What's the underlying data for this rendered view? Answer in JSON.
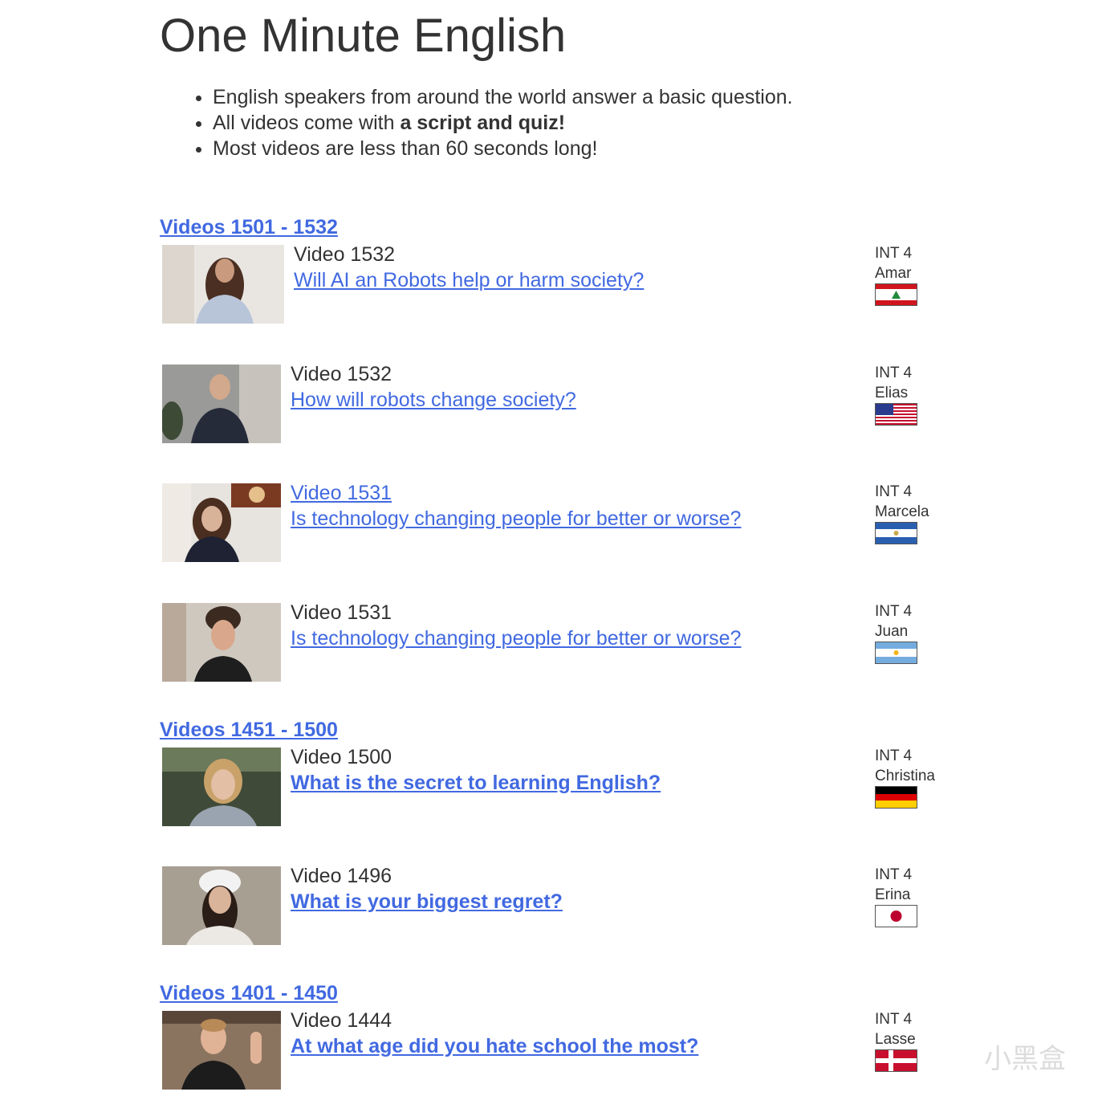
{
  "page": {
    "title": "One Minute English",
    "bullets": {
      "b1": "English speakers from around the world answer a basic question.",
      "b2_prefix": "All videos come with ",
      "b2_bold": "a script and quiz!",
      "b3": "Most videos are less than 60 seconds long!"
    }
  },
  "groups": [
    {
      "label": "Videos 1501 - 1532"
    },
    {
      "label": "Videos 1451 - 1500"
    },
    {
      "label": "Videos 1401 - 1450"
    }
  ],
  "videos": [
    {
      "number": "Video 1532",
      "question": "Will AI an Robots help or harm society?",
      "level": "INT 4",
      "speaker": "Amar",
      "flag_icon": "lebanon-flag-icon"
    },
    {
      "number": "Video 1532",
      "question": "How will robots change society?",
      "level": "INT 4",
      "speaker": "Elias",
      "flag_icon": "usa-flag-icon"
    },
    {
      "number": "Video 1531",
      "question": "Is technology changing people for better or worse?",
      "level": "INT 4",
      "speaker": "Marcela",
      "flag_icon": "el-salvador-flag-icon"
    },
    {
      "number": "Video 1531",
      "question": "Is technology changing people for better or worse?",
      "level": "INT 4",
      "speaker": "Juan",
      "flag_icon": "argentina-flag-icon"
    },
    {
      "number": "Video 1500",
      "question": "What is the secret to learning English?",
      "level": "INT 4",
      "speaker": "Christina",
      "flag_icon": "germany-flag-icon"
    },
    {
      "number": "Video 1496",
      "question": "What is your biggest regret?",
      "level": "INT 4",
      "speaker": "Erina",
      "flag_icon": "japan-flag-icon"
    },
    {
      "number": "Video 1444",
      "question": "At what age did you hate school the most?",
      "level": "INT 4",
      "speaker": "Lasse",
      "flag_icon": "denmark-flag-icon"
    }
  ],
  "colors": {
    "link": "#4169e1",
    "text": "#333333"
  },
  "watermark": {
    "text": "小黑盒"
  }
}
